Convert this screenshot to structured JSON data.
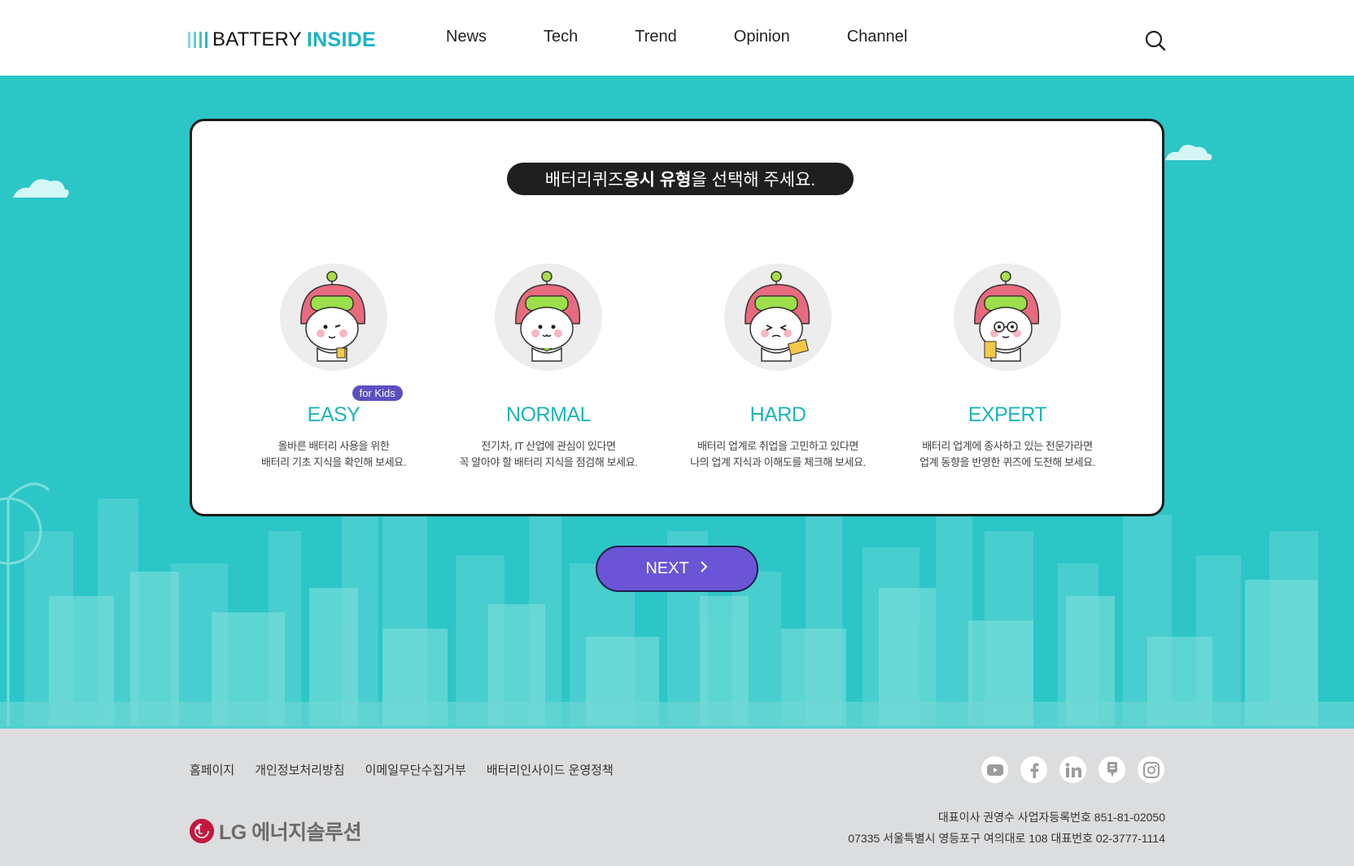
{
  "header": {
    "logo_part1": "BATTERY",
    "logo_part2": "INSIDE",
    "nav": [
      "News",
      "Tech",
      "Trend",
      "Opinion",
      "Channel"
    ],
    "search_icon": "search-icon"
  },
  "quiz": {
    "prompt_before": "배터리퀴즈 ",
    "prompt_bold": "응시 유형",
    "prompt_after": "을 선택해 주세요.",
    "options": [
      {
        "title": "EASY",
        "badge": "for Kids",
        "desc_line1": "올바른 배터리 사용을 위한",
        "desc_line2": "배터리 기초 지식을 확인해 보세요."
      },
      {
        "title": "NORMAL",
        "desc_line1": "전기차, IT 산업에 관심이 있다면",
        "desc_line2": "꼭 알아야 할 배터리 지식을 점검해 보세요."
      },
      {
        "title": "HARD",
        "desc_line1": "배터리 업계로 취업을 고민하고 있다면",
        "desc_line2": "나의 업계 지식과 이해도를 체크해 보세요."
      },
      {
        "title": "EXPERT",
        "desc_line1": "배터리 업계에 종사하고 있는 전문가라면",
        "desc_line2": "업계 동향을 반영한 퀴즈에 도전해 보세요."
      }
    ],
    "next_label": "NEXT"
  },
  "footer": {
    "links": [
      "홈페이지",
      "개인정보처리방침",
      "이메일무단수집거부",
      "배터리인사이드 운영정책"
    ],
    "social": [
      "youtube-icon",
      "facebook-icon",
      "linkedin-icon",
      "blog-icon",
      "instagram-icon"
    ],
    "brand": "LG 에너지솔루션",
    "info_line1": "대표이사 권영수 사업자등록번호 851-81-02050",
    "info_line2": "07335 서울특별시 영등포구 여의대로 108 대표번호 02-3777-1114"
  },
  "colors": {
    "accent_teal": "#2cc6c7",
    "title_teal": "#1cb5b8",
    "button_purple": "#6b55d6",
    "badge_purple": "#5a4fc2",
    "lg_red": "#c4183d"
  }
}
